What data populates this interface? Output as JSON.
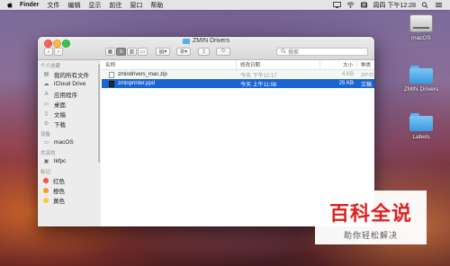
{
  "menubar": {
    "apple_icon": "apple-icon",
    "app": "Finder",
    "items": [
      "文件",
      "编辑",
      "显示",
      "前往",
      "窗口",
      "帮助"
    ],
    "clock": "周四 下午12:28"
  },
  "desktop": {
    "icons": [
      {
        "label": "macOS",
        "icon": "hard-drive-icon"
      },
      {
        "label": "ZMIN Drivers",
        "icon": "folder-icon"
      },
      {
        "label": "Labels",
        "icon": "folder-icon"
      }
    ]
  },
  "window": {
    "title": "ZMIN Drivers",
    "search_placeholder": "搜索",
    "sidebar": {
      "favorites_header": "个人收藏",
      "favorites": [
        {
          "label": "我的所有文件",
          "icon": "all-files-icon"
        },
        {
          "label": "iCloud Drive",
          "icon": "cloud-icon"
        },
        {
          "label": "应用程序",
          "icon": "applications-icon"
        },
        {
          "label": "桌面",
          "icon": "desktop-icon"
        },
        {
          "label": "文稿",
          "icon": "documents-icon"
        },
        {
          "label": "下载",
          "icon": "downloads-icon"
        }
      ],
      "devices_header": "设备",
      "devices": [
        {
          "label": "macOS",
          "icon": "disk-icon"
        }
      ],
      "shared_header": "共享的",
      "shared": [
        {
          "label": "lkfpc",
          "icon": "computer-icon"
        }
      ],
      "tags_header": "标记",
      "tags": [
        {
          "label": "红色",
          "color": "#fc4c4e"
        },
        {
          "label": "橙色",
          "color": "#fd9a2e"
        },
        {
          "label": "黄色",
          "color": "#fecc2f"
        }
      ]
    },
    "columns": {
      "name": "名称",
      "date": "修改日期",
      "size": "大小",
      "kind": "种类"
    },
    "files": [
      {
        "name": "zmindrivers_mac.zip",
        "date": "今天 下午12:17",
        "size": "4 KB",
        "kind": "ZIP 归"
      },
      {
        "name": "zminprinter.ppd",
        "date": "今天 上午11:08",
        "size": "25 KB",
        "kind": "文稿",
        "selected": true
      }
    ]
  },
  "watermark": {
    "main": "百科全说",
    "sub": "助你轻松解决"
  }
}
